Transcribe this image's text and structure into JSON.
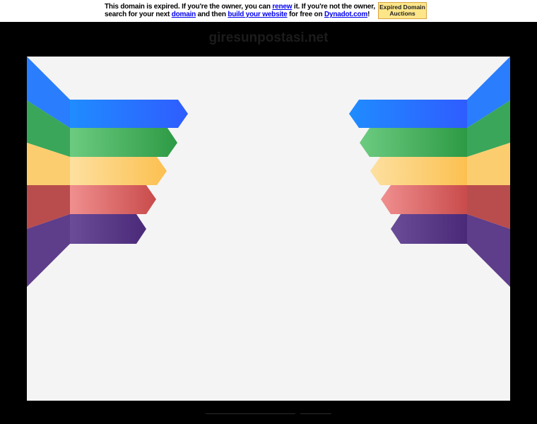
{
  "notice": {
    "text_1": "This domain is expired. If you're the owner, you can ",
    "renew_link": "renew",
    "text_2": " it. If you're not the owner, search for your next ",
    "domain_link": "domain",
    "text_3": " and then ",
    "build_link": "build your website",
    "text_4": " for free on ",
    "dynadot_link": "Dynadot.com",
    "text_5": "!"
  },
  "auctions_button": {
    "line_1": "Expired Domain",
    "line_2": "Auctions"
  },
  "site_title": "giresunpostasi.net",
  "colors": {
    "background": "#000000",
    "stage": "#f4f4f4",
    "blue": "#2a7dfc",
    "green": "#3aa65a",
    "yellow": "#fcd27a",
    "red": "#e06d6d",
    "purple": "#5e3d8a"
  }
}
